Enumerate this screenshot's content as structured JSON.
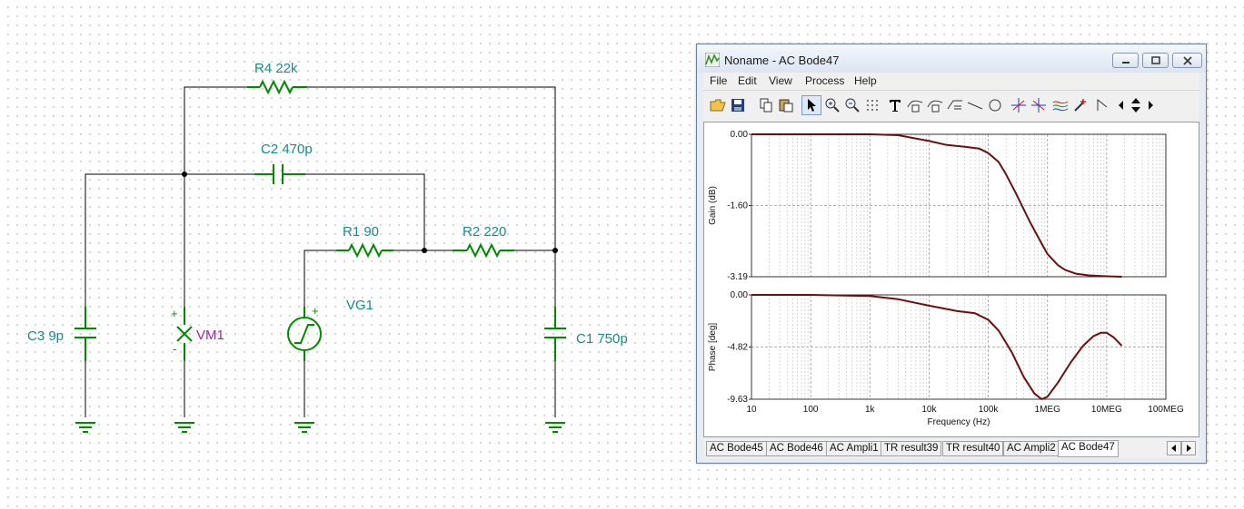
{
  "schematic": {
    "labels": {
      "r4": "R4 22k",
      "c2": "C2 470p",
      "r1": "R1 90",
      "r2": "R2 220",
      "vg1": "VG1",
      "c3": "C3 9p",
      "vm1": "VM1",
      "c1": "C1 750p",
      "plus": "+",
      "minus": "-"
    },
    "colors": {
      "component": "#008a00",
      "label": "#1a8a8a",
      "meter_label": "#a0299a",
      "wire": "#000000",
      "pin": "#b00000"
    }
  },
  "window": {
    "title": "Noname - AC Bode47",
    "menu": [
      "File",
      "Edit",
      "View",
      "Process",
      "Help"
    ],
    "toolbar_icons": [
      "open-icon",
      "save-icon",
      "copy-icon",
      "paste-icon",
      "pointer-icon",
      "zoom-in-icon",
      "zoom-100-icon",
      "grid-icon",
      "text-icon",
      "curve-label-icon",
      "curve-label2-icon",
      "slope-icon",
      "line-icon",
      "circle-icon",
      "cursor-a-icon",
      "cursor-b-icon",
      "waves-icon",
      "marker-icon",
      "polyline-icon",
      "scroll-left-icon",
      "scroll-updown-icon",
      "scroll-right-icon"
    ],
    "tabs": [
      "AC Bode45",
      "AC Bode46",
      "AC Ampli1",
      "TR result39",
      "TR result40",
      "AC Ampli2",
      "AC Bode47"
    ],
    "selected_tab": "AC Bode47"
  },
  "chart_data": [
    {
      "type": "line",
      "ylabel": "Gain (dB)",
      "xscale": "log",
      "xlim": [
        10,
        100000000
      ],
      "ylim": [
        -3.19,
        0.0
      ],
      "yticks": [
        "0.00",
        "-1.60",
        "-3.19"
      ],
      "grid": true,
      "line_color": "#6b0f0f",
      "x": [
        10,
        100,
        1000,
        3000,
        10000,
        20000,
        40000,
        70000,
        100000,
        150000,
        200000,
        300000,
        500000,
        800000,
        1000000,
        1500000,
        2000000,
        3000000,
        5000000,
        10000000,
        18000000
      ],
      "y": [
        0.0,
        0.0,
        0.0,
        -0.02,
        -0.15,
        -0.24,
        -0.28,
        -0.32,
        -0.42,
        -0.62,
        -0.9,
        -1.35,
        -1.95,
        -2.45,
        -2.68,
        -2.93,
        -3.04,
        -3.12,
        -3.16,
        -3.18,
        -3.19
      ]
    },
    {
      "type": "line",
      "ylabel": "Phase [deg]",
      "xlabel": "Frequency (Hz)",
      "xscale": "log",
      "xlim": [
        10,
        100000000
      ],
      "ylim": [
        -9.63,
        0.0
      ],
      "yticks": [
        "0.00",
        "-4.82",
        "-9.63"
      ],
      "xticks": [
        "10",
        "100",
        "1k",
        "10k",
        "100k",
        "1MEG",
        "10MEG",
        "100MEG"
      ],
      "grid": true,
      "line_color": "#6b0f0f",
      "x": [
        10,
        100,
        1000,
        3000,
        10000,
        30000,
        60000,
        100000,
        150000,
        250000,
        400000,
        600000,
        800000,
        1000000,
        1500000,
        2500000,
        4000000,
        6000000,
        8000000,
        10000000,
        13000000,
        18000000
      ],
      "y": [
        0.0,
        0.0,
        -0.1,
        -0.4,
        -1.0,
        -1.5,
        -1.7,
        -2.3,
        -3.3,
        -5.3,
        -7.6,
        -9.1,
        -9.63,
        -9.4,
        -8.1,
        -6.2,
        -4.7,
        -3.8,
        -3.5,
        -3.5,
        -3.9,
        -4.7
      ]
    }
  ]
}
